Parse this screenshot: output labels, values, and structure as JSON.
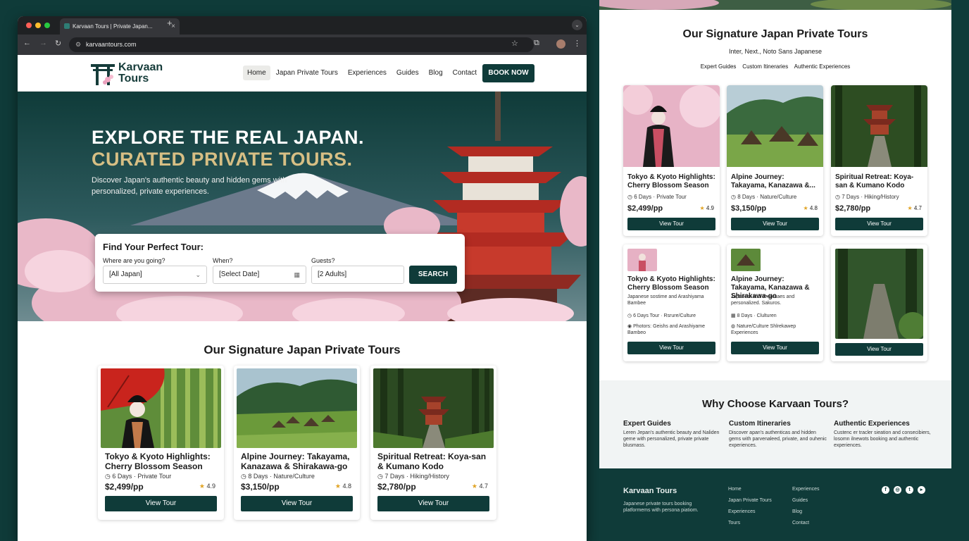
{
  "browser": {
    "tab_title": "Karvaan Tours | Private Japan...",
    "url": "karvaantours.com"
  },
  "site": {
    "logo_text": "Karvaan Tours",
    "nav": [
      "Home",
      "Japan Private Tours",
      "Experiences",
      "Guides",
      "Blog",
      "Contact"
    ],
    "book_now": "BOOK NOW"
  },
  "hero": {
    "headline_1": "EXPLORE THE REAL JAPAN.",
    "headline_2": "CURATED PRIVATE TOURS.",
    "subtitle": "Discover Japan's authentic beauty and hidden gems with personalized, private experiences."
  },
  "search": {
    "title": "Find Your Perfect Tour:",
    "where_label": "Where are you going?",
    "where_value": "[All Japan]",
    "when_label": "When?",
    "when_value": "[Select Date]",
    "guests_label": "Guests?",
    "guests_value": "[2 Adults]",
    "button": "SEARCH"
  },
  "signature": {
    "title": "Our Signature Japan Private Tours",
    "tours": [
      {
        "name": "Tokyo & Kyoto Highlights: Cherry Blossom Season",
        "meta": "6 Days · Private Tour",
        "price": "$2,499/pp",
        "rating": "4.9",
        "button": "View Tour"
      },
      {
        "name": "Alpine Journey: Takayama, Kanazawa & Shirakawa-go",
        "meta": "8 Days · Nature/Culture",
        "price": "$3,150/pp",
        "rating": "4.8",
        "button": "View Tour"
      },
      {
        "name": "Spiritual Retreat: Koya-san & Kumano Kodo",
        "meta": "7 Days · Hiking/History",
        "price": "$2,780/pp",
        "rating": "4.7",
        "button": "View Tour"
      }
    ]
  },
  "right_panel": {
    "title": "Our Signature Japan Private Tours",
    "fonts_line": "Inter, Next., Noto Sans Japanese",
    "tags": [
      "Expert Guides",
      "Custom Itineraries",
      "Authentic Experiences"
    ],
    "top_cards": [
      {
        "name": "Tokyo & Kyoto Highlights: Cherry Blossom Season",
        "meta": "6 Days · Private Tour",
        "price": "$2,499/pp",
        "rating": "4.9",
        "button": "View Tour"
      },
      {
        "name": "Alpine Journey: Takayama, Kanazawa &...",
        "meta": "8 Days · Nature/Culture",
        "price": "$3,150/pp",
        "rating": "4.8",
        "button": "View Tour"
      },
      {
        "name": "Spiritual Retreat: Koya-san & Kumano Kodo",
        "meta": "7 Days · Hiking/History",
        "price": "$2,780/pp",
        "rating": "4.7",
        "button": "View Tour"
      }
    ],
    "bottom_cards": [
      {
        "name": "Tokyo & Kyoto Highlights: Cherry Blossom Season",
        "desc": "Japanese sostime and Arashiyama Bambee",
        "line1": "6 Days Tour · Rsrure/Culture",
        "line2": "Photors: Geishs and Arashiyame Bambeo",
        "button": "View Tour"
      },
      {
        "name": "Alpine Journey: Takayama, Kanazawa & Shirakawa-go",
        "desc": "Japanesr and shoresaes and personalized. Sakuros.",
        "line1": "8 Days · Clulturen",
        "line2": "Nature/Culture Shlrekawep Experiences",
        "button": "View Tour"
      },
      {
        "button": "View Tour"
      }
    ],
    "why": {
      "title": "Why Choose Karvaan Tours?",
      "cols": [
        {
          "h": "Expert Guides",
          "d": "Leren Jepan's authentic beauty and Naliden geme with personalized, private private blusmass."
        },
        {
          "h": "Custom Itineraries",
          "d": "Discover apan's authenticas and hidden gems with parvenaleed, private, and ouhenic experiences."
        },
        {
          "h": "Authentic Experiences",
          "d": "Custenc er tracler sieation and consecibiers, losomn ilnewots booking and authentic experiences."
        }
      ]
    },
    "footer": {
      "brand": "Karvaan Tours",
      "desc": "Japanese private tours booking platformems with persona piatiom.",
      "links_col1": [
        "Home",
        "Japan Private Tours",
        "Experiences",
        "Tours"
      ],
      "links_col2": [
        "Experiences",
        "Guides",
        "Blog",
        "Contact"
      ]
    }
  },
  "colors": {
    "primary": "#0f3b39",
    "gold": "#d7bf84",
    "star": "#e0a323"
  }
}
